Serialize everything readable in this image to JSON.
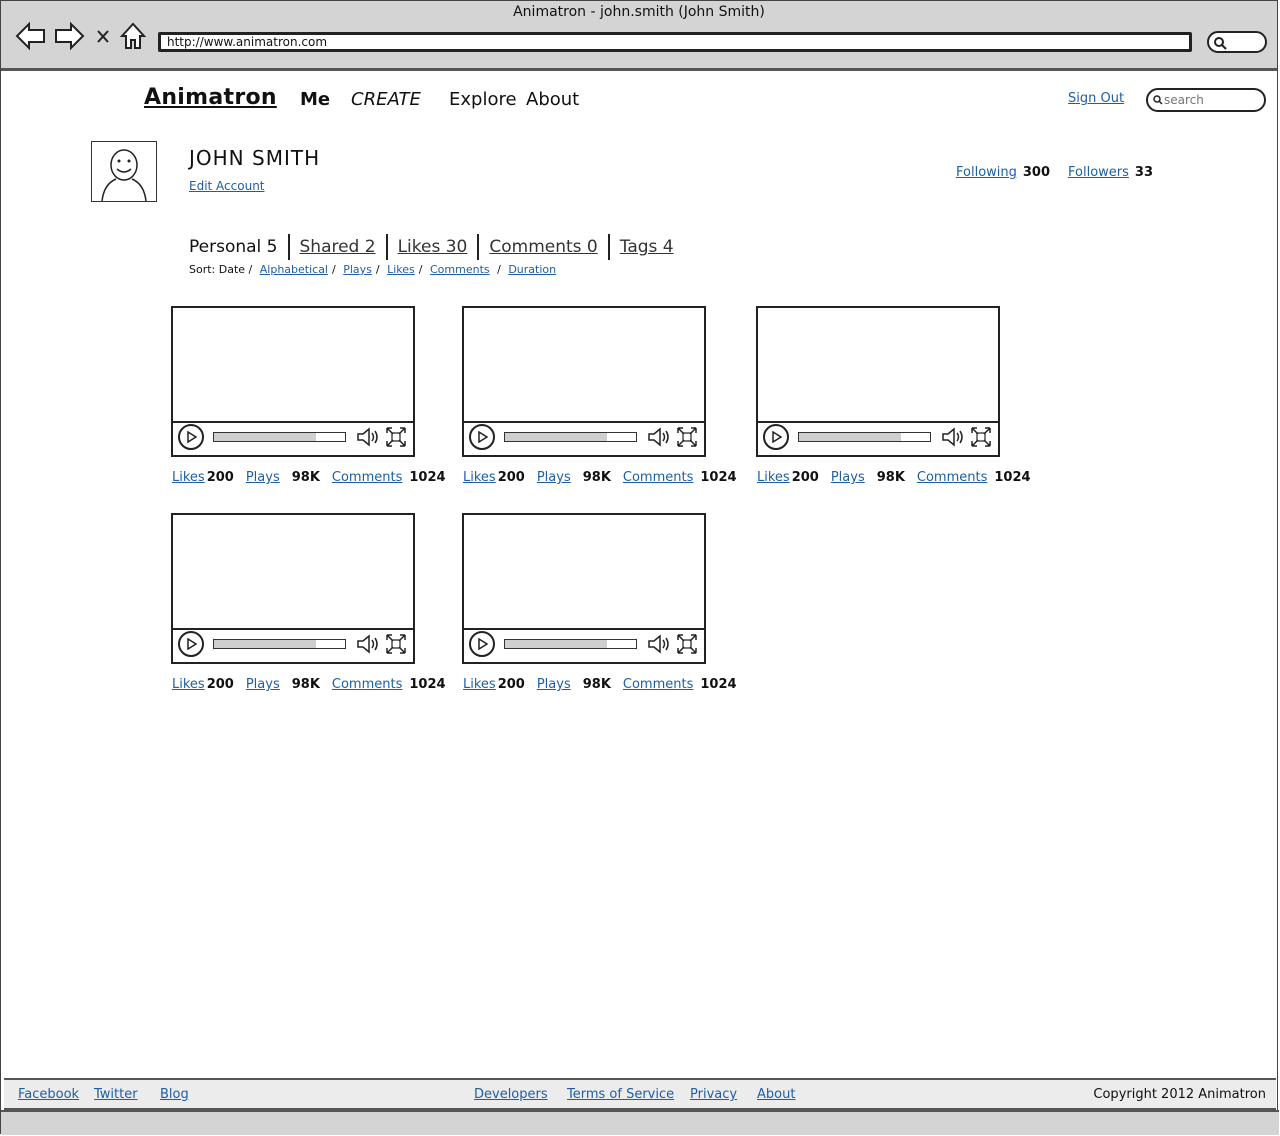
{
  "window": {
    "title": "Animatron - john.smith (John Smith)",
    "url": "http://www.animatron.com"
  },
  "header": {
    "brand": "Animatron",
    "menu": [
      "Me",
      "CREATE",
      "Explore",
      "About"
    ],
    "sign_out": "Sign Out",
    "search_placeholder": "search"
  },
  "profile": {
    "name": "JOHN SMITH",
    "edit_account": "Edit Account",
    "following_label": "Following",
    "following_count": "300",
    "followers_label": "Followers",
    "followers_count": "33"
  },
  "tabs": [
    {
      "label": "Personal 5",
      "active": true
    },
    {
      "label": "Shared 2",
      "active": false
    },
    {
      "label": "Likes 30",
      "active": false
    },
    {
      "label": "Comments 0",
      "active": false
    },
    {
      "label": "Tags 4",
      "active": false
    }
  ],
  "sort": {
    "prefix": "Sort: Date /",
    "options": [
      "Alphabetical",
      "Plays",
      "Likes",
      "Comments",
      "Duration"
    ]
  },
  "videos": [
    {
      "likes_label": "Likes",
      "likes": "200",
      "plays_label": "Plays",
      "plays": "98K",
      "comments_label": "Comments",
      "comments": "1024",
      "progress": 0.78
    },
    {
      "likes_label": "Likes",
      "likes": "200",
      "plays_label": "Plays",
      "plays": "98K",
      "comments_label": "Comments",
      "comments": "1024",
      "progress": 0.78
    },
    {
      "likes_label": "Likes",
      "likes": "200",
      "plays_label": "Plays",
      "plays": "98K",
      "comments_label": "Comments",
      "comments": "1024",
      "progress": 0.78
    },
    {
      "likes_label": "Likes",
      "likes": "200",
      "plays_label": "Plays",
      "plays": "98K",
      "comments_label": "Comments",
      "comments": "1024",
      "progress": 0.78
    },
    {
      "likes_label": "Likes",
      "likes": "200",
      "plays_label": "Plays",
      "plays": "98K",
      "comments_label": "Comments",
      "comments": "1024",
      "progress": 0.78
    }
  ],
  "footer": {
    "left_links": [
      "Facebook",
      "Twitter",
      "Blog"
    ],
    "center_links": [
      "Developers",
      "Terms of Service",
      "Privacy",
      "About"
    ],
    "copyright": "Copyright 2012 Animatron"
  }
}
